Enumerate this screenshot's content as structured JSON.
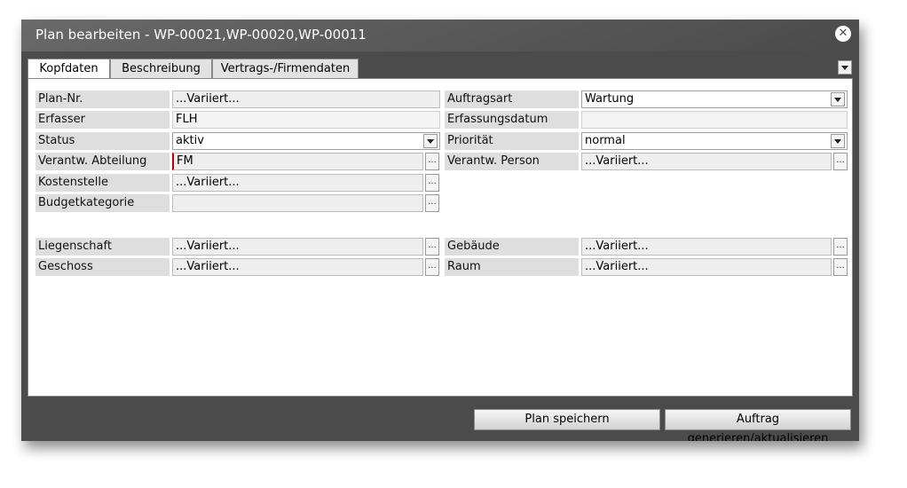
{
  "dialog": {
    "title": "Plan bearbeiten - WP-00021,WP-00020,WP-00011"
  },
  "tabs": [
    {
      "label": "Kopfdaten"
    },
    {
      "label": "Beschreibung"
    },
    {
      "label": "Vertrags-/Firmendaten"
    }
  ],
  "form": {
    "plan_nr": {
      "label": "Plan-Nr.",
      "value": "...Variiert..."
    },
    "erfasser": {
      "label": "Erfasser",
      "value": "FLH"
    },
    "status": {
      "label": "Status",
      "value": "aktiv"
    },
    "abteilung": {
      "label": "Verantw. Abteilung",
      "value": "FM"
    },
    "kostenstelle": {
      "label": "Kostenstelle",
      "value": "...Variiert..."
    },
    "budgetkategorie": {
      "label": "Budgetkategorie",
      "value": ""
    },
    "auftragsart": {
      "label": "Auftragsart",
      "value": "Wartung"
    },
    "erfassungsdatum": {
      "label": "Erfassungsdatum",
      "value": ""
    },
    "prioritaet": {
      "label": "Priorität",
      "value": "normal"
    },
    "person": {
      "label": "Verantw. Person",
      "value": "...Variiert..."
    },
    "liegenschaft": {
      "label": "Liegenschaft",
      "value": "...Variiert..."
    },
    "geschoss": {
      "label": "Geschoss",
      "value": "...Variiert..."
    },
    "gebaeude": {
      "label": "Gebäude",
      "value": "...Variiert..."
    },
    "raum": {
      "label": "Raum",
      "value": "...Variiert..."
    },
    "ellipsis": "..."
  },
  "buttons": {
    "save": "Plan speichern",
    "generate": "Auftrag generieren/aktualisieren"
  }
}
